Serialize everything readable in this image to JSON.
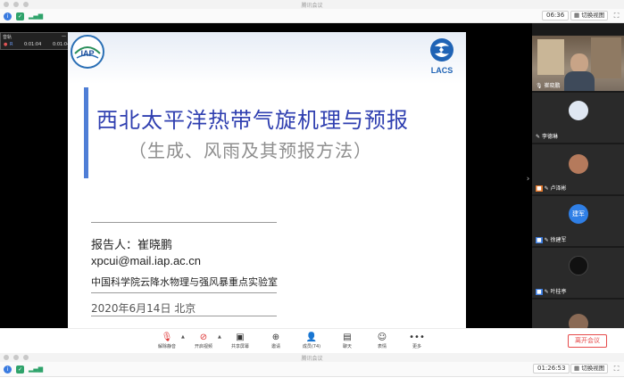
{
  "window": {
    "title": "腾讯会议"
  },
  "status_top": {
    "time": "06:36",
    "view_label": "切换视图"
  },
  "status_bottom": {
    "time": "01:26:53",
    "view_label": "切换视图"
  },
  "recorder": {
    "label": "音轨",
    "time_current": "0:01:04",
    "time_total": "0:01:04"
  },
  "slide": {
    "logo_left_text": "IAP",
    "logo_right_text": "LACS",
    "title": "西北太平洋热带气旋机理与预报",
    "subtitle": "（生成、风雨及其预报方法）",
    "reporter": "报告人：崔晓鹏",
    "email": "xpcui@mail.iap.ac.cn",
    "affiliation": "中国科学院云降水物理与强风暴重点实验室",
    "date_place": "2020年6月14日    北京"
  },
  "participants": [
    {
      "name": "崔晓鹏",
      "type": "camera"
    },
    {
      "name": "李德琳",
      "type": "avatar"
    },
    {
      "name": "卢泽彬",
      "type": "avatar"
    },
    {
      "name": "徐建军",
      "type": "avatar",
      "avatar_text": "建军"
    },
    {
      "name": "叶桂亭",
      "type": "avatar"
    },
    {
      "name": "",
      "type": "avatar"
    }
  ],
  "toolbar": {
    "mute_label": "解除静音",
    "video_label": "开启视频",
    "share_label": "共享屏幕",
    "invite_label": "邀请",
    "members_label": "成员(74)",
    "chat_label": "聊天",
    "emoji_label": "表情",
    "more_label": "更多",
    "leave_label": "离开会议"
  },
  "colors": {
    "title_blue": "#2f3fb0",
    "accent_bar": "#4f7ed6",
    "leave_red": "#e64a4a",
    "panel_bg": "#1a1a1a"
  }
}
